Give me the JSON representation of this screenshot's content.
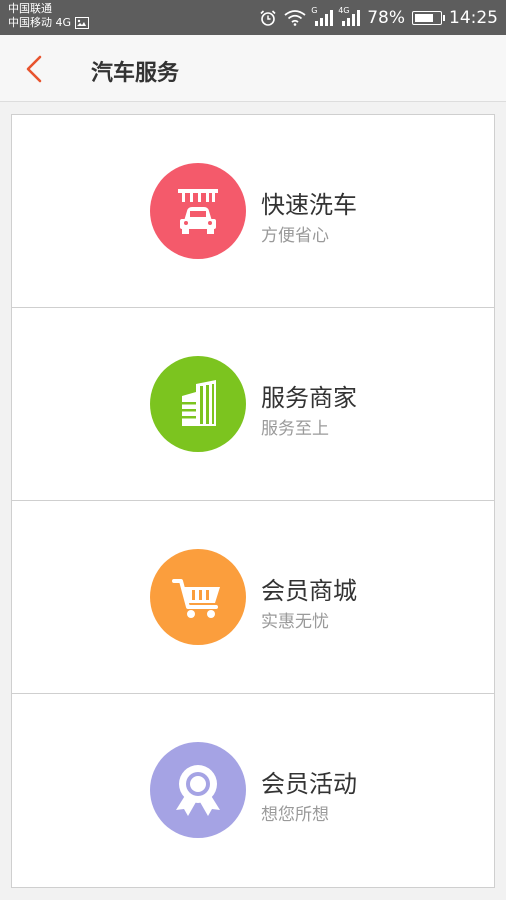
{
  "status_bar": {
    "carrier1": "中国联通",
    "carrier2": "中国移动 4G",
    "signal1_label": "G",
    "signal2_label": "4G",
    "battery_text": "78%",
    "battery_level": 0.78,
    "time": "14:25"
  },
  "header": {
    "title": "汽车服务",
    "back_icon": "chevron-left-icon",
    "accent": "#e8542e"
  },
  "services": [
    {
      "title": "快速洗车",
      "subtitle": "方便省心",
      "icon": "car-wash-icon",
      "color": "#f45a6b"
    },
    {
      "title": "服务商家",
      "subtitle": "服务至上",
      "icon": "building-icon",
      "color": "#7cc41f"
    },
    {
      "title": "会员商城",
      "subtitle": "实惠无忧",
      "icon": "shopping-cart-icon",
      "color": "#fb9e3d"
    },
    {
      "title": "会员活动",
      "subtitle": "想您所想",
      "icon": "award-ribbon-icon",
      "color": "#a5a3e4"
    }
  ]
}
